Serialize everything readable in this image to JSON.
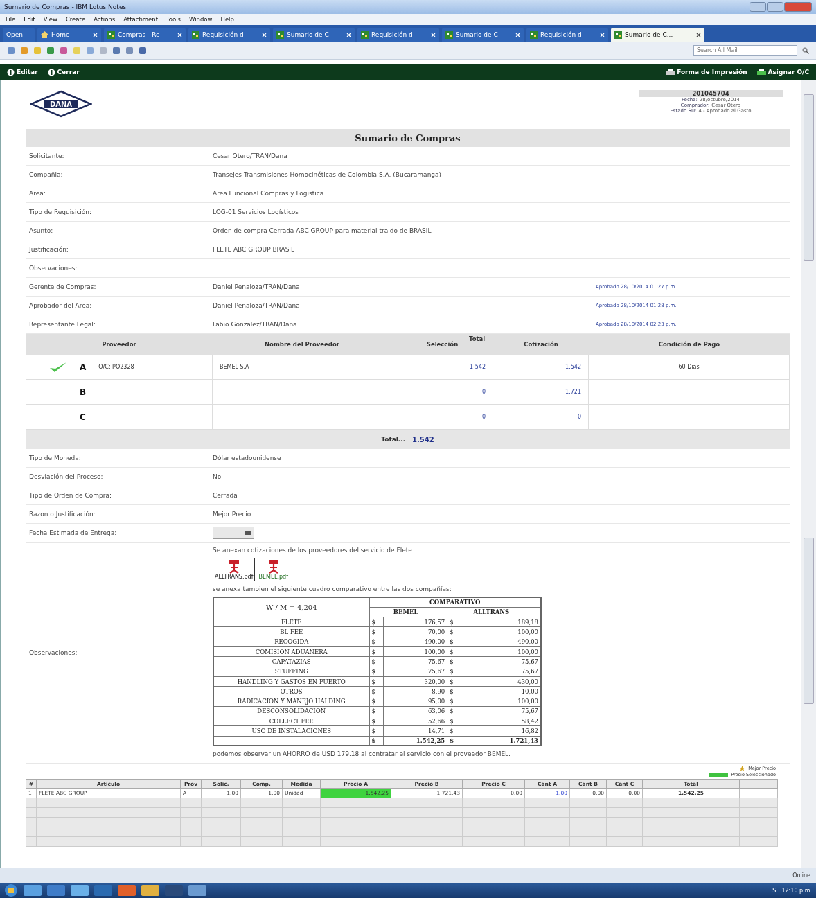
{
  "window": {
    "title": "Sumario de Compras - IBM Lotus Notes"
  },
  "menu": [
    "File",
    "Edit",
    "View",
    "Create",
    "Actions",
    "Attachment",
    "Tools",
    "Window",
    "Help"
  ],
  "tabs": [
    {
      "label": "Open",
      "kind": "open",
      "selected": false
    },
    {
      "label": "Home",
      "kind": "home",
      "selected": false
    },
    {
      "label": "Compras - Re",
      "kind": "doc",
      "selected": false
    },
    {
      "label": "Requisición d",
      "kind": "doc",
      "selected": false
    },
    {
      "label": "Sumario de C",
      "kind": "doc",
      "selected": false
    },
    {
      "label": "Requisición d",
      "kind": "doc",
      "selected": false
    },
    {
      "label": "Sumario de C",
      "kind": "doc",
      "selected": false
    },
    {
      "label": "Requisición d",
      "kind": "doc",
      "selected": false
    },
    {
      "label": "Sumario de C...",
      "kind": "doc",
      "selected": true
    }
  ],
  "search": {
    "placeholder": "Search All Mail"
  },
  "actions_left": [
    "Editar",
    "Cerrar"
  ],
  "actions_right": [
    "Forma de Impresión",
    "Asignar O/C"
  ],
  "logo": "DANA",
  "header": {
    "number": "201045704",
    "fecha_label": "Fecha:",
    "fecha": "28/octubre/2014",
    "comprador_label": "Comprador:",
    "comprador": "Cesar Otero",
    "estado_label": "Estado SU:",
    "estado": "4 - Aprobado al Gasto"
  },
  "title": "Sumario de Compras",
  "fields": [
    {
      "label": "Solicitante:",
      "value": "Cesar Otero/TRAN/Dana"
    },
    {
      "label": "Compañia:",
      "value": "Transejes Transmisiones Homocinéticas de Colombia S.A. (Bucaramanga)"
    },
    {
      "label": "Area:",
      "value": "Area Funcional Compras y Logistica"
    },
    {
      "label": "Tipo de Requisición:",
      "value": "LOG-01  Servicios Logísticos"
    },
    {
      "label": "Asunto:",
      "value": "Orden de compra Cerrada ABC GROUP para material traido de BRASIL"
    },
    {
      "label": "Justificación:",
      "value": "FLETE ABC GROUP BRASIL"
    },
    {
      "label": "Observaciones:"
    },
    {
      "label": "Gerente de Compras:",
      "value": "Daniel Penaloza/TRAN/Dana",
      "approval": "Aprobado 28/10/2014 01:27 p.m."
    },
    {
      "label": "Aprobador del Area:",
      "value": "Daniel Penaloza/TRAN/Dana",
      "approval": "Aprobado 28/10/2014 01:28 p.m."
    },
    {
      "label": "Representante Legal:",
      "value": "Fabio Gonzalez/TRAN/Dana",
      "approval": "Aprobado 28/10/2014 02:23 p.m."
    }
  ],
  "providers": {
    "columns": [
      "Proveedor",
      "Nombre del Proveedor",
      "Total",
      "Selección",
      "Cotización",
      "Condición de Pago"
    ],
    "rows": [
      {
        "letter": "A",
        "selected": true,
        "oc": "O/C: PO2328",
        "name": "BEMEL S.A",
        "seleccion": "1.542",
        "cotizacion": "1.542",
        "condicion": "60 Dias"
      },
      {
        "letter": "B",
        "selected": false,
        "seleccion": "0",
        "cotizacion": "1.721"
      },
      {
        "letter": "C",
        "selected": false,
        "seleccion": "0",
        "cotizacion": "0"
      }
    ],
    "total_label": "Total...",
    "total": "1.542"
  },
  "fields2": [
    {
      "label": "Tipo de Moneda:",
      "value": "Dólar estadounidense"
    },
    {
      "label": "Desviación del Proceso:",
      "value": "No"
    },
    {
      "label": "Tipo de Orden de Compra:",
      "value": "Cerrada"
    },
    {
      "label": "Razon o Justificación:",
      "value": "Mejor Precio"
    },
    {
      "label": "Fecha Estimada de Entrega:",
      "kind": "date"
    }
  ],
  "observaciones": {
    "label": "Observaciones:",
    "intro": "Se anexan cotizaciones de los proveedores del servicio de Flete",
    "attachments": [
      {
        "name": "ALLTRANS.pdf",
        "selected": true
      },
      {
        "name": "BEMEL.pdf",
        "selected": false
      }
    ],
    "note": "se anexa tambien el siguiente cuadro comparativo entre las dos compañías:",
    "comparison": {
      "corner": "W / M = 4,204",
      "group": "COMPARATIVO",
      "columns": [
        "",
        "",
        "BEMEL",
        "",
        "ALLTRANS"
      ],
      "rows": [
        [
          "FLETE",
          "$",
          "176,57",
          "$",
          "189,18"
        ],
        [
          "BL FEE",
          "$",
          "70,00",
          "$",
          "100,00"
        ],
        [
          "RECOGIDA",
          "$",
          "490,00",
          "$",
          "490,00"
        ],
        [
          "COMISION ADUANERA",
          "$",
          "100,00",
          "$",
          "100,00"
        ],
        [
          "CAPATAZIAS",
          "$",
          "75,67",
          "$",
          "75,67"
        ],
        [
          "STUFFING",
          "$",
          "75,67",
          "$",
          "75,67"
        ],
        [
          "HANDLING Y GASTOS EN PUERTO",
          "$",
          "320,00",
          "$",
          "430,00"
        ],
        [
          "OTROS",
          "$",
          "8,90",
          "$",
          "10,00"
        ],
        [
          "RADICACION Y MANEJO HALDING",
          "$",
          "95,00",
          "$",
          "100,00"
        ],
        [
          "DESCONSOLIDACION",
          "$",
          "63,06",
          "$",
          "75,67"
        ],
        [
          "COLLECT FEE",
          "$",
          "52,66",
          "$",
          "58,42"
        ],
        [
          "USO DE INSTALACIONES",
          "$",
          "14,71",
          "$",
          "16,82"
        ]
      ],
      "total": [
        "$",
        "1.542,25",
        "$",
        "1.721,43"
      ]
    },
    "conclusion": "podemos observar un AHORRO de USD 179.18 al contratar el servicio con el proveedor BEMEL."
  },
  "legend": [
    {
      "label": "Mejor Precio",
      "kind": "star"
    },
    {
      "label": "Precio Seleccionado",
      "kind": "swatch"
    }
  ],
  "items": {
    "columns": [
      "#",
      "Articulo",
      "Prov",
      "Solic.",
      "Comp.",
      "Medida",
      "Precio A",
      "Precio B",
      "Precio C",
      "Cant A",
      "Cant B",
      "Cant C",
      "Total"
    ],
    "rows": [
      {
        "cells": [
          "1",
          "FLETE ABC GROUP",
          "A",
          "1,00",
          "1,00",
          "Unidad",
          "1,542.25",
          "1,721.43",
          "0.00",
          "1.00",
          "0.00",
          "0.00",
          "1.542,25"
        ],
        "price_selection": [
          {
            "selected": true
          },
          {
            "selected": false
          },
          {
            "selected": false
          }
        ]
      }
    ]
  },
  "status_bar": {
    "status": "Online"
  },
  "taskbar": {
    "language": "ES",
    "time": "12:10 p.m."
  }
}
